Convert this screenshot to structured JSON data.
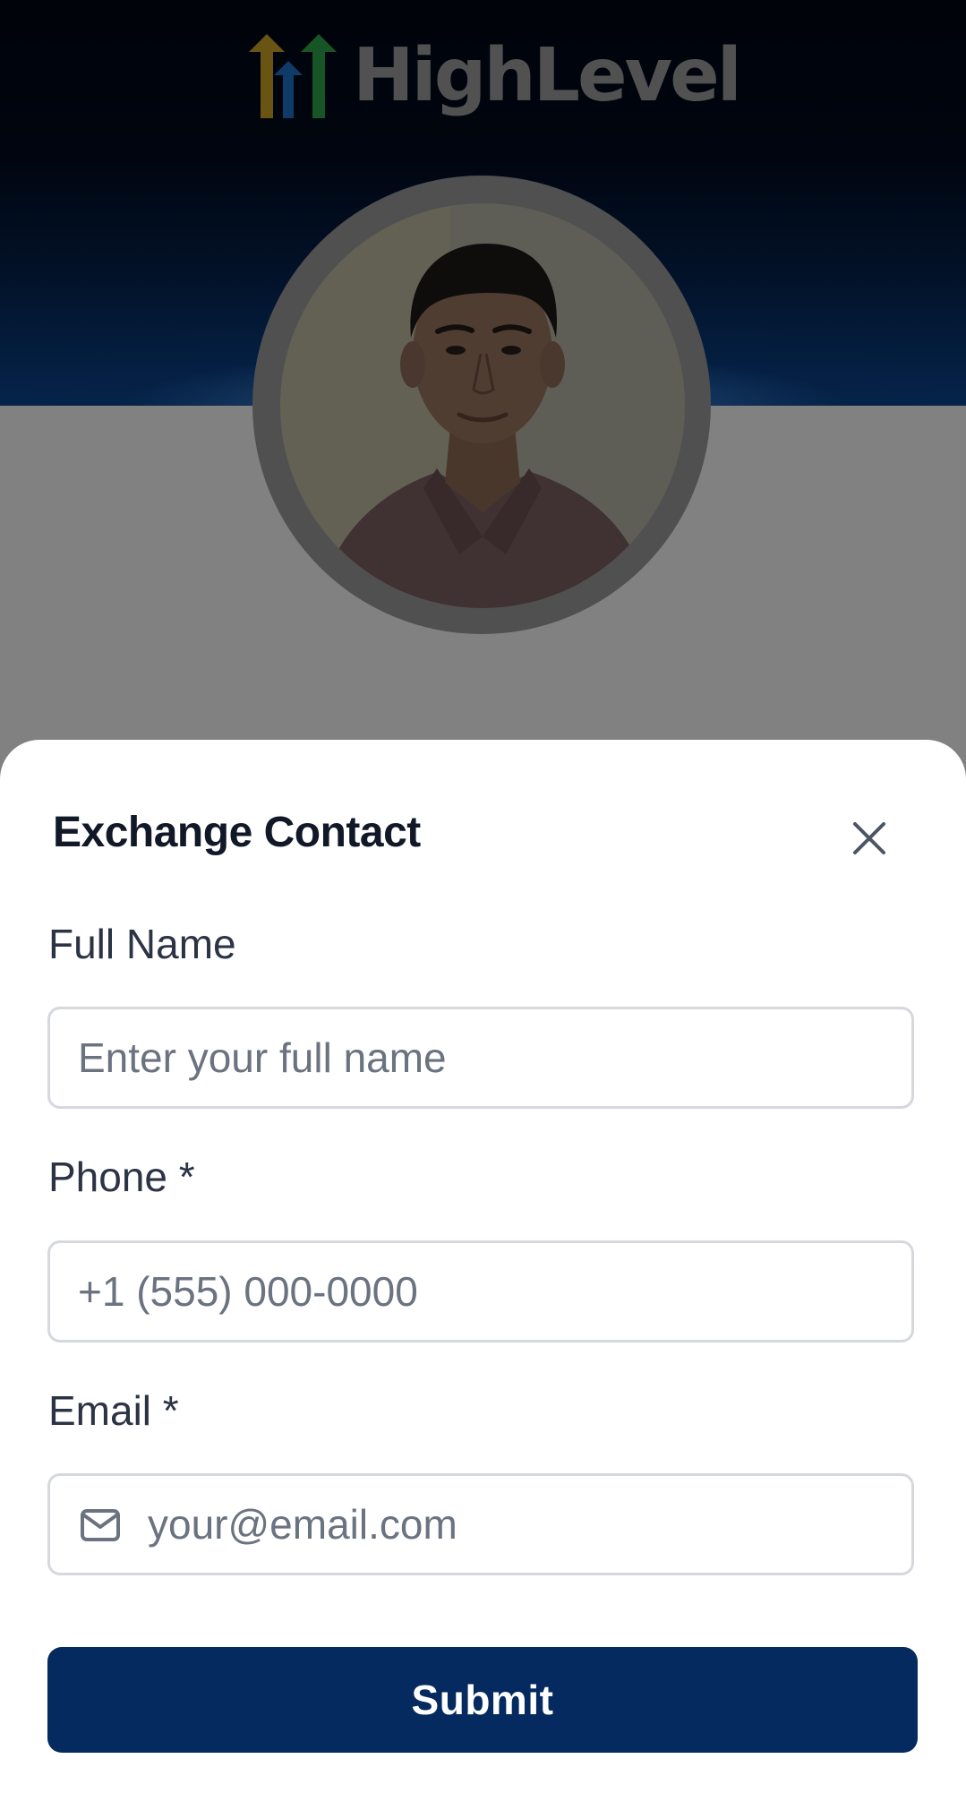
{
  "profile": {
    "brand": {
      "name": "HighLevel",
      "mark_colors": [
        "#c9a228",
        "#1f72c9",
        "#2da24a"
      ]
    },
    "avatar_icon": "profile-photo"
  },
  "exchange_sheet": {
    "title": "Exchange Contact",
    "close_icon": "close-icon",
    "fields": {
      "full_name": {
        "label": "Full Name",
        "placeholder": "Enter your full name",
        "value": ""
      },
      "phone": {
        "label": "Phone *",
        "placeholder": "+1 (555) 000-0000",
        "value": ""
      },
      "email": {
        "label": "Email *",
        "placeholder": "your@email.com",
        "value": "",
        "icon": "mail-icon"
      }
    },
    "submit_label": "Submit",
    "colors": {
      "primary": "#042a5f",
      "title": "#111827",
      "label": "#2b3344",
      "placeholder": "#6b7280",
      "border": "#d5d8dd"
    }
  }
}
